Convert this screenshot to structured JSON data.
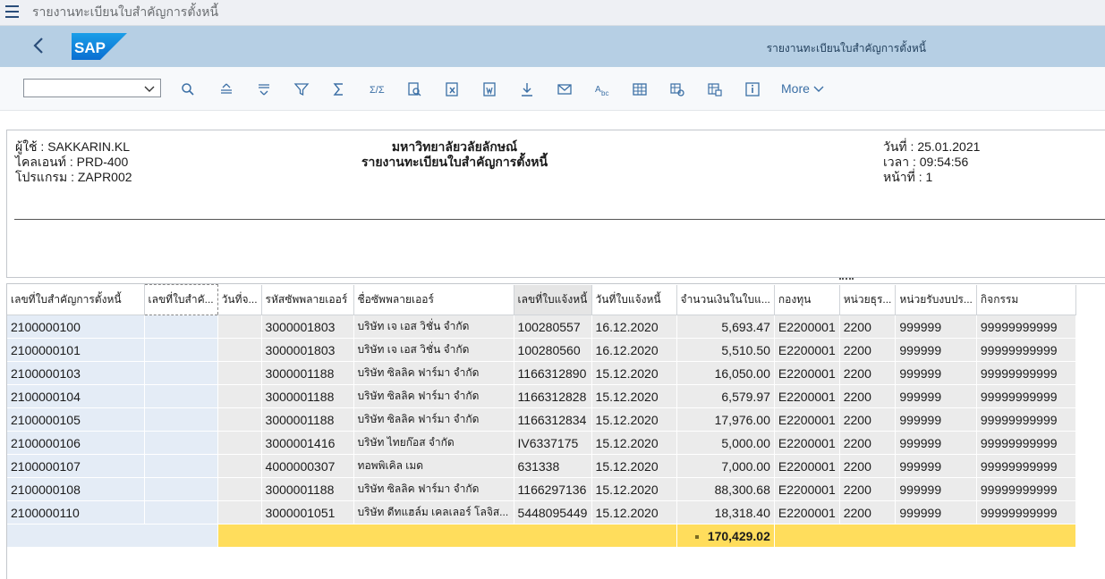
{
  "window_title": "รายงานทะเบียนใบสำคัญการตั้งหนี้",
  "shell": {
    "title": "รายงานทะเบียนใบสำคัญการตั้งหนี้",
    "logo_text": "SAP"
  },
  "toolbar": {
    "layout_select_value": "",
    "more_label": "More"
  },
  "report_header": {
    "user": "ผู้ใช้ : SAKKARIN.KL",
    "client": "ไคลเอนท์ : PRD-400",
    "program": "โปรแกรม : ZAPR002",
    "org_name": "มหาวิทยาลัยวลัยลักษณ์",
    "report_title": "รายงานทะเบียนใบสำคัญการตั้งหนี้",
    "date": "วันที่ : 25.01.2021",
    "time": "เวลา : 09:54:56",
    "page": "หน้าที่ : 1"
  },
  "table": {
    "columns": [
      "เลขที่ใบสำคัญการตั้งหนี้",
      "เลขที่ใบสำคั...",
      "วันที่จ...",
      "รหัสซัพพลายเออร์",
      "ชื่อซัพพลายเออร์",
      "เลขที่ใบแจ้งหนี้",
      "วันที่ใบแจ้งหนี้",
      "จำนวนเงินในใบแ...",
      "กองทุน",
      "หน่วยธุร...",
      "หน่วยรับงบปร...",
      "กิจกรรม"
    ],
    "rows": [
      [
        "2100000100",
        "",
        "",
        "3000001803",
        "บริษัท เจ เอส วิชั่น จำกัด",
        "100280557",
        "16.12.2020",
        "5,693.47",
        "E2200001",
        "2200",
        "999999",
        "99999999999"
      ],
      [
        "2100000101",
        "",
        "",
        "3000001803",
        "บริษัท เจ เอส วิชั่น จำกัด",
        "100280560",
        "16.12.2020",
        "5,510.50",
        "E2200001",
        "2200",
        "999999",
        "99999999999"
      ],
      [
        "2100000103",
        "",
        "",
        "3000001188",
        "บริษัท ซิลลิค ฟาร์มา จำกัด",
        "1166312890",
        "15.12.2020",
        "16,050.00",
        "E2200001",
        "2200",
        "999999",
        "99999999999"
      ],
      [
        "2100000104",
        "",
        "",
        "3000001188",
        "บริษัท ซิลลิค ฟาร์มา จำกัด",
        "1166312828",
        "15.12.2020",
        "6,579.97",
        "E2200001",
        "2200",
        "999999",
        "99999999999"
      ],
      [
        "2100000105",
        "",
        "",
        "3000001188",
        "บริษัท ซิลลิค ฟาร์มา จำกัด",
        "1166312834",
        "15.12.2020",
        "17,976.00",
        "E2200001",
        "2200",
        "999999",
        "99999999999"
      ],
      [
        "2100000106",
        "",
        "",
        "3000001416",
        "บริษัท ไทยก๊อส จำกัด",
        "IV6337175",
        "15.12.2020",
        "5,000.00",
        "E2200001",
        "2200",
        "999999",
        "99999999999"
      ],
      [
        "2100000107",
        "",
        "",
        "4000000307",
        "ทอพพิเคิล เมด",
        "631338",
        "15.12.2020",
        "7,000.00",
        "E2200001",
        "2200",
        "999999",
        "99999999999"
      ],
      [
        "2100000108",
        "",
        "",
        "3000001188",
        "บริษัท ซิลลิค ฟาร์มา จำกัด",
        "1166297136",
        "15.12.2020",
        "88,300.68",
        "E2200001",
        "2200",
        "999999",
        "99999999999"
      ],
      [
        "2100000110",
        "",
        "",
        "3000001051",
        "บริษัท ดีทแฮล์ม เคลเลอร์ โลจิส...",
        "5448095449",
        "15.12.2020",
        "18,318.40",
        "E2200001",
        "2200",
        "999999",
        "99999999999"
      ]
    ],
    "total": "170,429.02"
  }
}
